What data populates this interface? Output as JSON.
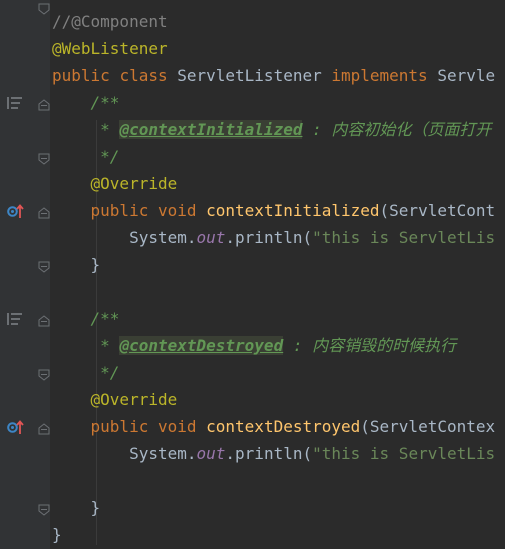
{
  "editor": {
    "lines": [
      {
        "id": "l0",
        "parts": [
          {
            "t": "//@Component",
            "c": "cmt"
          }
        ]
      },
      {
        "id": "l1",
        "parts": [
          {
            "t": "@WebListener",
            "c": "ann"
          }
        ]
      },
      {
        "id": "l2",
        "parts": [
          {
            "t": "public ",
            "c": "kw"
          },
          {
            "t": "class ",
            "c": "kw"
          },
          {
            "t": "ServletListener ",
            "c": ""
          },
          {
            "t": "implements ",
            "c": "kw"
          },
          {
            "t": "Servle",
            "c": ""
          }
        ]
      },
      {
        "id": "l3",
        "parts": [
          {
            "t": "    ",
            "c": ""
          },
          {
            "t": "/**",
            "c": "doc"
          }
        ]
      },
      {
        "id": "l4",
        "parts": [
          {
            "t": "     * ",
            "c": "doc"
          },
          {
            "t": "@contextInitialized",
            "c": "doctag"
          },
          {
            "t": " : ",
            "c": "doc"
          },
          {
            "t": "内容初始化（页面打开",
            "c": "doc cjk"
          }
        ]
      },
      {
        "id": "l5",
        "parts": [
          {
            "t": "     */",
            "c": "doc"
          }
        ]
      },
      {
        "id": "l6",
        "parts": [
          {
            "t": "    ",
            "c": ""
          },
          {
            "t": "@Override",
            "c": "ann"
          }
        ]
      },
      {
        "id": "l7",
        "parts": [
          {
            "t": "    ",
            "c": ""
          },
          {
            "t": "public ",
            "c": "kw"
          },
          {
            "t": "void ",
            "c": "kw"
          },
          {
            "t": "contextInitialized",
            "c": "fn"
          },
          {
            "t": "(ServletCont",
            "c": ""
          }
        ]
      },
      {
        "id": "l8",
        "parts": [
          {
            "t": "        System.",
            "c": ""
          },
          {
            "t": "out",
            "c": "field"
          },
          {
            "t": ".println(",
            "c": ""
          },
          {
            "t": "\"this is ServletLis",
            "c": "str"
          }
        ]
      },
      {
        "id": "l9",
        "parts": [
          {
            "t": "    }",
            "c": ""
          }
        ]
      },
      {
        "id": "l10",
        "parts": [
          {
            "t": "",
            "c": ""
          }
        ]
      },
      {
        "id": "l11",
        "parts": [
          {
            "t": "    ",
            "c": ""
          },
          {
            "t": "/**",
            "c": "doc"
          }
        ]
      },
      {
        "id": "l12",
        "parts": [
          {
            "t": "     * ",
            "c": "doc"
          },
          {
            "t": "@contextDestroyed",
            "c": "doctag"
          },
          {
            "t": " : ",
            "c": "doc"
          },
          {
            "t": "内容销毁的时候执行",
            "c": "doc cjk"
          }
        ]
      },
      {
        "id": "l13",
        "parts": [
          {
            "t": "     */",
            "c": "doc"
          }
        ]
      },
      {
        "id": "l14",
        "parts": [
          {
            "t": "    ",
            "c": ""
          },
          {
            "t": "@Override",
            "c": "ann"
          }
        ]
      },
      {
        "id": "l15",
        "parts": [
          {
            "t": "    ",
            "c": ""
          },
          {
            "t": "public ",
            "c": "kw"
          },
          {
            "t": "void ",
            "c": "kw"
          },
          {
            "t": "contextDestroyed",
            "c": "fn"
          },
          {
            "t": "(ServletContex",
            "c": ""
          }
        ]
      },
      {
        "id": "l16",
        "parts": [
          {
            "t": "        System.",
            "c": ""
          },
          {
            "t": "out",
            "c": "field"
          },
          {
            "t": ".println(",
            "c": ""
          },
          {
            "t": "\"this is ServletLis",
            "c": "str"
          }
        ]
      },
      {
        "id": "l17",
        "parts": [
          {
            "t": "",
            "c": ""
          }
        ]
      },
      {
        "id": "l18",
        "parts": [
          {
            "t": "    }",
            "c": ""
          }
        ]
      },
      {
        "id": "l19",
        "parts": [
          {
            "t": "}",
            "c": ""
          }
        ]
      }
    ]
  },
  "gutter_icons": [
    {
      "line": 3,
      "icon": "doc-render-icon"
    },
    {
      "line": 7,
      "icon": "implemented-method-icon"
    },
    {
      "line": 11,
      "icon": "doc-render-icon"
    },
    {
      "line": 15,
      "icon": "implemented-method-icon"
    }
  ],
  "colors": {
    "background": "#2b2b2b",
    "gutter": "#313335",
    "keyword": "#cc7832",
    "annotation": "#bbb529",
    "comment": "#808080",
    "doc_comment": "#629755",
    "method": "#ffc66d",
    "string": "#6a8759",
    "field": "#9876aa",
    "plain": "#a9b7c6",
    "gutter_icon": "#3d86c6",
    "override_arrow": "#e05555"
  }
}
